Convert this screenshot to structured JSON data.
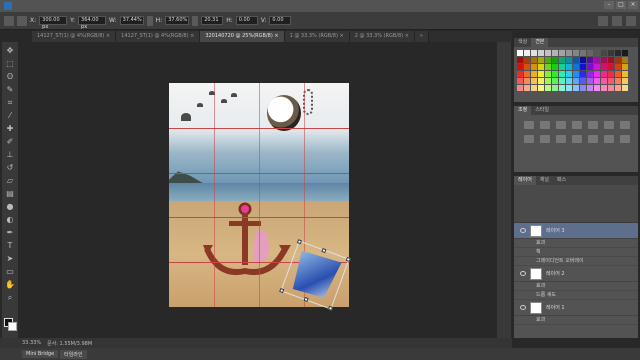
{
  "menubar": {
    "title": ""
  },
  "options": {
    "x_label": "X:",
    "x_value": "300.00 px",
    "y_label": "Y:",
    "y_value": "364.00 px",
    "w_label": "W:",
    "w_value": "37.44%",
    "h_label": "H:",
    "h_value": "37.60%",
    "angle_value": "20.31",
    "h_skew_label": "H:",
    "h_skew_value": "0.00",
    "v_skew_label": "V:",
    "v_skew_value": "0.00"
  },
  "tabs": [
    {
      "label": "14127_ST(1) @ 4%(RGB/8) ×"
    },
    {
      "label": "14127_ST(1) @ 4%(RGB/8) ×"
    },
    {
      "label": "320140720 @ 25%(RGB/8) ×"
    },
    {
      "label": "1 @ 33.3% (RGB/8) ×"
    },
    {
      "label": "2 @ 33.3% (RGB/8) ×"
    },
    {
      "label": "»"
    }
  ],
  "status": {
    "zoom": "33.33%",
    "doc_info": "문서: 1.55M/3.98M"
  },
  "bottom_tabs": [
    "Mini Bridge",
    "타임라인"
  ],
  "panels": {
    "swatches_tabs": [
      "색상",
      "견본"
    ],
    "adjustments_tabs": [
      "조정",
      "스타일"
    ],
    "layers_tabs": [
      "레이어",
      "채널",
      "패스"
    ],
    "layers": [
      {
        "name": "레이어 3",
        "selected": true
      },
      {
        "name": "효과"
      },
      {
        "name": "획"
      },
      {
        "name": "그레이디언트 오버레이"
      },
      {
        "name": "레이어 2",
        "selected": false
      },
      {
        "name": "효과"
      },
      {
        "name": "드롭 섀도"
      },
      {
        "name": "레이어 1",
        "selected": false
      },
      {
        "name": "효과"
      }
    ]
  },
  "colors": {
    "selected_layer": "#5d6f8c",
    "grid": "#c84646"
  }
}
